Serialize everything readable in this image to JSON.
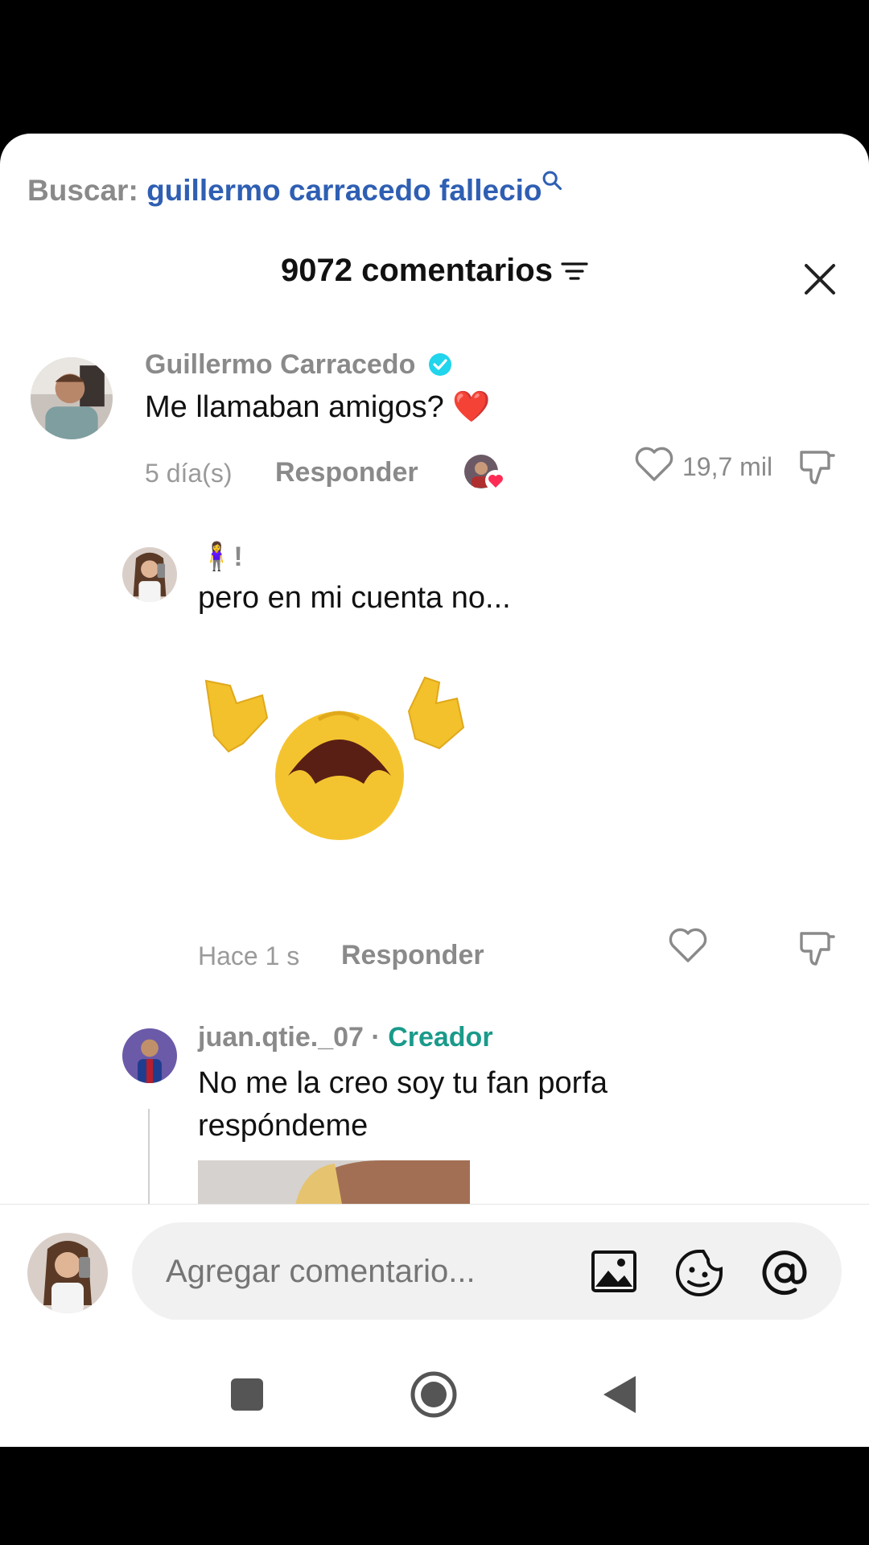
{
  "search": {
    "prefix": "Buscar:",
    "query": "guillermo carracedo fallecio"
  },
  "header": {
    "title": "9072 comentarios"
  },
  "comments": [
    {
      "author": "Guillermo Carracedo",
      "verified": true,
      "text": "Me llamaban amigos? ❤️",
      "time": "5 día(s)",
      "reply_label": "Responder",
      "likes": "19,7 mil"
    },
    {
      "author": "🧍‍♀️!",
      "text": "pero en mi cuenta no...",
      "time": "Hace 1 s",
      "reply_label": "Responder",
      "sticker": "crying-emoji-sticker"
    },
    {
      "author": "juan.qtie._07",
      "separator": " · ",
      "badge": "Creador",
      "text": "No me la creo soy tu fan porfa respóndeme"
    }
  ],
  "composer": {
    "placeholder": "Agregar comentario..."
  },
  "colors": {
    "accent_blue": "#2f5fb3",
    "creator_green": "#1a9a8a",
    "verified": "#20d5ec",
    "heart_red": "#fe2c55"
  },
  "icons": [
    "search-icon",
    "sort-icon",
    "close-icon",
    "heart-icon",
    "dislike-icon",
    "image-icon",
    "sticker-icon",
    "mention-icon",
    "square-nav-icon",
    "home-nav-icon",
    "back-nav-icon"
  ]
}
